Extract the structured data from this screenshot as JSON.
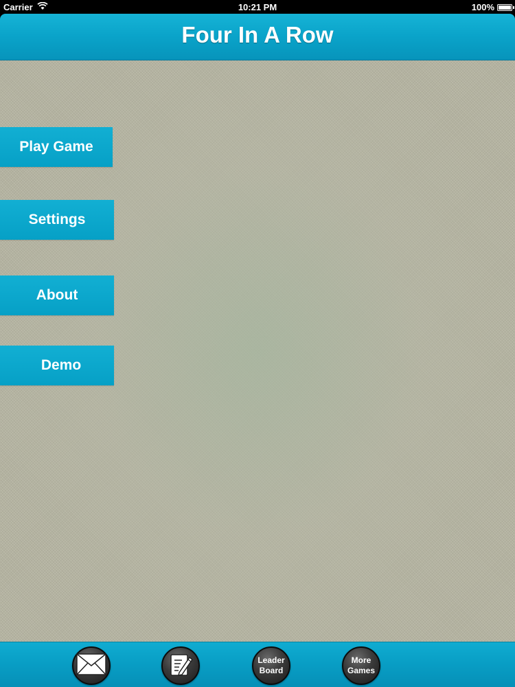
{
  "status_bar": {
    "carrier": "Carrier",
    "time": "10:21 PM",
    "battery": "100%"
  },
  "header": {
    "title": "Four In A Row"
  },
  "menu": {
    "play_label": "Play Game",
    "settings_label": "Settings",
    "about_label": "About",
    "demo_label": "Demo"
  },
  "footer": {
    "leaderboard_label": "Leader\nBoard",
    "more_games_label": "More\nGames"
  },
  "colors": {
    "accent": "#0aa3c9",
    "background": "#b9b8a5",
    "round_button": "#2e2e2e"
  },
  "icons": {
    "mail": "mail-icon",
    "notes": "notepad-pencil-icon",
    "wifi": "wifi-icon",
    "battery": "battery-icon"
  }
}
